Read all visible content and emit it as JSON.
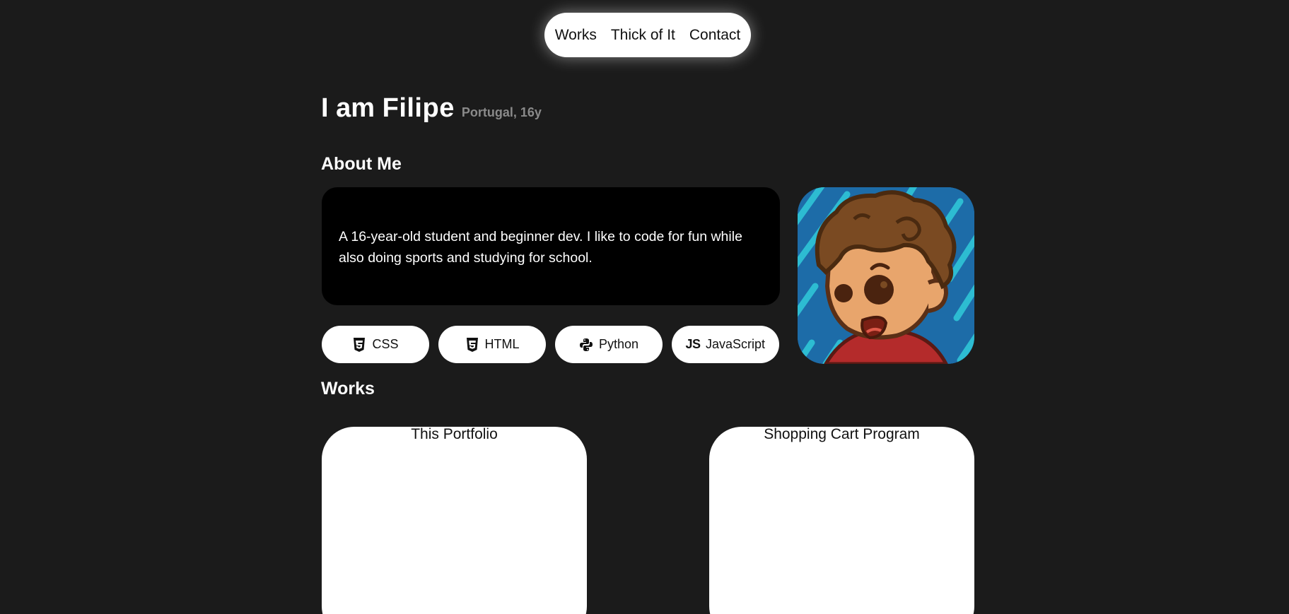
{
  "nav": {
    "items": [
      "Works",
      "Thick of It",
      "Contact"
    ]
  },
  "header": {
    "greeting": "I am",
    "name": "Filipe",
    "meta": "Portugal, 16y"
  },
  "about": {
    "title": "About Me",
    "text": "A 16-year-old student and beginner dev. I like to code for fun while also doing sports and studying for school."
  },
  "skills": [
    {
      "label": "CSS",
      "icon": "css3-icon"
    },
    {
      "label": "HTML",
      "icon": "html5-icon"
    },
    {
      "label": "Python",
      "icon": "python-icon"
    },
    {
      "label": "JavaScript",
      "icon": "js-icon"
    }
  ],
  "works": {
    "title": "Works",
    "items": [
      {
        "title": "This Portfolio"
      },
      {
        "title": "Shopping Cart Program"
      }
    ]
  },
  "colors": {
    "background": "#1b1b1b",
    "card_dark": "#000000",
    "pill": "#ffffff",
    "meta_text": "#8a8a8a"
  }
}
